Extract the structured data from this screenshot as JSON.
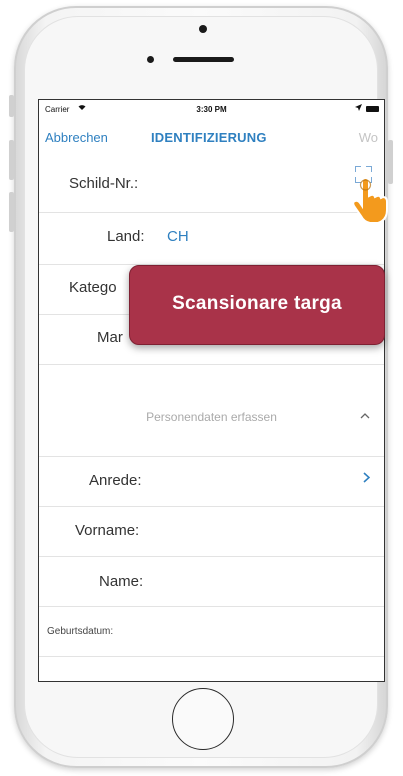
{
  "status_bar": {
    "carrier": "Carrier",
    "time": "3:30 PM"
  },
  "nav": {
    "cancel_label": "Abbrechen",
    "title": "IDENTIFIZIERUNG",
    "right_label": "Wo"
  },
  "form": {
    "schild_label": "Schild-Nr.:",
    "land_label": "Land:",
    "land_value": "CH",
    "kategorie_label_visible": "Katego",
    "marke_label_visible": "Mar"
  },
  "section": {
    "title": "Personendaten erfassen"
  },
  "person": {
    "anrede_label": "Anrede:",
    "vorname_label": "Vorname:",
    "name_label": "Name:",
    "geburtsdatum_label": "Geburtsdatum:"
  },
  "tooltip": {
    "text": "Scansionare targa"
  },
  "colors": {
    "accent": "#2f80c0",
    "tooltip_bg": "#a93349",
    "hand": "#f39a1d"
  }
}
